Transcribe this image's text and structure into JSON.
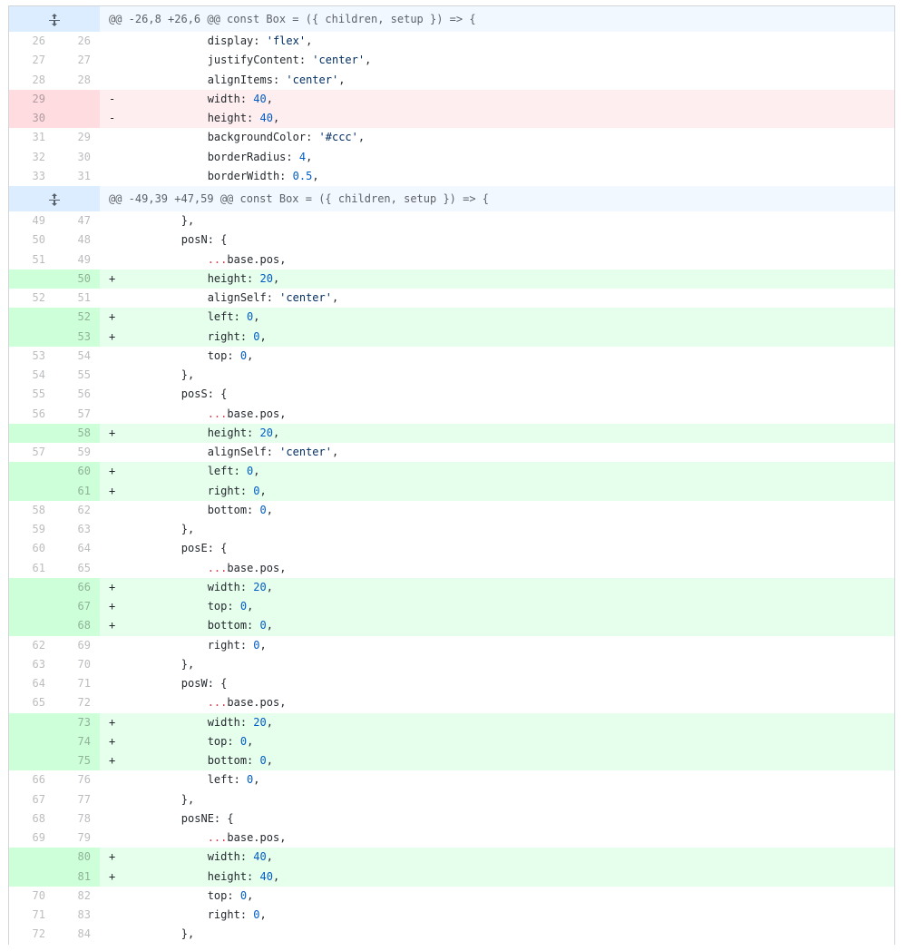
{
  "diff": {
    "colors": {
      "addition": "#e6ffed",
      "deletion": "#ffeef0",
      "hunk": "#f1f8ff",
      "number": "#005cc5",
      "spread": "#d73a49"
    },
    "rows": [
      {
        "type": "hunk",
        "text": "@@ -26,8 +26,6 @@ const Box = ({ children, setup }) => {",
        "icon": "unfold-icon"
      },
      {
        "type": "ctx",
        "old": "26",
        "new": "26",
        "code": "            display: 'flex',"
      },
      {
        "type": "ctx",
        "old": "27",
        "new": "27",
        "code": "            justifyContent: 'center',"
      },
      {
        "type": "ctx",
        "old": "28",
        "new": "28",
        "code": "            alignItems: 'center',"
      },
      {
        "type": "del",
        "old": "29",
        "new": "",
        "code": "            width: 40,"
      },
      {
        "type": "del",
        "old": "30",
        "new": "",
        "code": "            height: 40,"
      },
      {
        "type": "ctx",
        "old": "31",
        "new": "29",
        "code": "            backgroundColor: '#ccc',"
      },
      {
        "type": "ctx",
        "old": "32",
        "new": "30",
        "code": "            borderRadius: 4,"
      },
      {
        "type": "ctx",
        "old": "33",
        "new": "31",
        "code": "            borderWidth: 0.5,"
      },
      {
        "type": "hunk",
        "text": "@@ -49,39 +47,59 @@ const Box = ({ children, setup }) => {",
        "icon": "unfold-icon"
      },
      {
        "type": "ctx",
        "old": "49",
        "new": "47",
        "code": "        },"
      },
      {
        "type": "ctx",
        "old": "50",
        "new": "48",
        "code": "        posN: {"
      },
      {
        "type": "ctx",
        "old": "51",
        "new": "49",
        "code": "            ...base.pos,"
      },
      {
        "type": "add",
        "old": "",
        "new": "50",
        "code": "            height: 20,"
      },
      {
        "type": "ctx",
        "old": "52",
        "new": "51",
        "code": "            alignSelf: 'center',"
      },
      {
        "type": "add",
        "old": "",
        "new": "52",
        "code": "            left: 0,"
      },
      {
        "type": "add",
        "old": "",
        "new": "53",
        "code": "            right: 0,"
      },
      {
        "type": "ctx",
        "old": "53",
        "new": "54",
        "code": "            top: 0,"
      },
      {
        "type": "ctx",
        "old": "54",
        "new": "55",
        "code": "        },"
      },
      {
        "type": "ctx",
        "old": "55",
        "new": "56",
        "code": "        posS: {"
      },
      {
        "type": "ctx",
        "old": "56",
        "new": "57",
        "code": "            ...base.pos,"
      },
      {
        "type": "add",
        "old": "",
        "new": "58",
        "code": "            height: 20,"
      },
      {
        "type": "ctx",
        "old": "57",
        "new": "59",
        "code": "            alignSelf: 'center',"
      },
      {
        "type": "add",
        "old": "",
        "new": "60",
        "code": "            left: 0,"
      },
      {
        "type": "add",
        "old": "",
        "new": "61",
        "code": "            right: 0,"
      },
      {
        "type": "ctx",
        "old": "58",
        "new": "62",
        "code": "            bottom: 0,"
      },
      {
        "type": "ctx",
        "old": "59",
        "new": "63",
        "code": "        },"
      },
      {
        "type": "ctx",
        "old": "60",
        "new": "64",
        "code": "        posE: {"
      },
      {
        "type": "ctx",
        "old": "61",
        "new": "65",
        "code": "            ...base.pos,"
      },
      {
        "type": "add",
        "old": "",
        "new": "66",
        "code": "            width: 20,"
      },
      {
        "type": "add",
        "old": "",
        "new": "67",
        "code": "            top: 0,"
      },
      {
        "type": "add",
        "old": "",
        "new": "68",
        "code": "            bottom: 0,"
      },
      {
        "type": "ctx",
        "old": "62",
        "new": "69",
        "code": "            right: 0,"
      },
      {
        "type": "ctx",
        "old": "63",
        "new": "70",
        "code": "        },"
      },
      {
        "type": "ctx",
        "old": "64",
        "new": "71",
        "code": "        posW: {"
      },
      {
        "type": "ctx",
        "old": "65",
        "new": "72",
        "code": "            ...base.pos,"
      },
      {
        "type": "add",
        "old": "",
        "new": "73",
        "code": "            width: 20,"
      },
      {
        "type": "add",
        "old": "",
        "new": "74",
        "code": "            top: 0,"
      },
      {
        "type": "add",
        "old": "",
        "new": "75",
        "code": "            bottom: 0,"
      },
      {
        "type": "ctx",
        "old": "66",
        "new": "76",
        "code": "            left: 0,"
      },
      {
        "type": "ctx",
        "old": "67",
        "new": "77",
        "code": "        },"
      },
      {
        "type": "ctx",
        "old": "68",
        "new": "78",
        "code": "        posNE: {"
      },
      {
        "type": "ctx",
        "old": "69",
        "new": "79",
        "code": "            ...base.pos,"
      },
      {
        "type": "add",
        "old": "",
        "new": "80",
        "code": "            width: 40,"
      },
      {
        "type": "add",
        "old": "",
        "new": "81",
        "code": "            height: 40,"
      },
      {
        "type": "ctx",
        "old": "70",
        "new": "82",
        "code": "            top: 0,"
      },
      {
        "type": "ctx",
        "old": "71",
        "new": "83",
        "code": "            right: 0,"
      },
      {
        "type": "ctx",
        "old": "72",
        "new": "84",
        "code": "        },"
      }
    ]
  }
}
